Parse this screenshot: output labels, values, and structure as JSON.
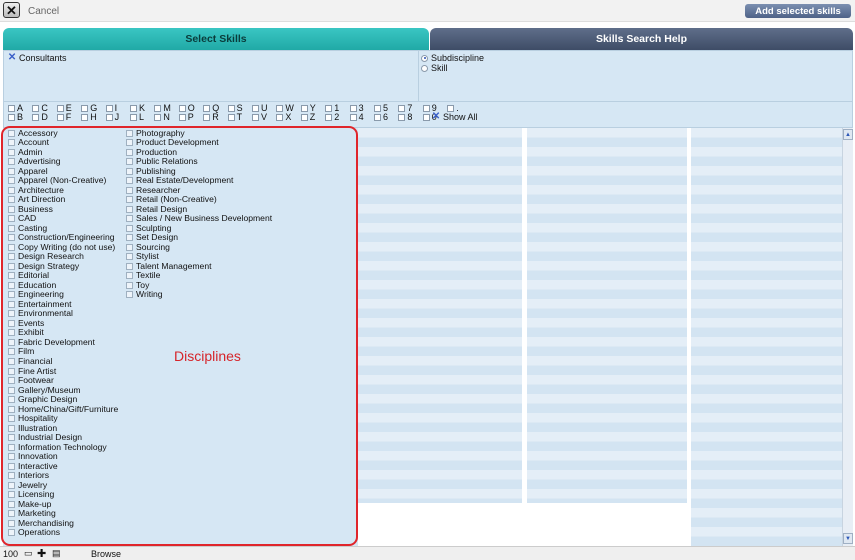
{
  "window": {
    "cancel_label": "Cancel",
    "add_button": "Add selected skills"
  },
  "tabs": [
    {
      "label": "Select Skills"
    },
    {
      "label": "Skills Search Help"
    }
  ],
  "filters": {
    "consultants": "Consultants",
    "subdiscipline": "Subdiscipline",
    "skill": "Skill"
  },
  "letters_row1": [
    "A",
    "C",
    "E",
    "G",
    "I",
    "K",
    "M",
    "O",
    "Q",
    "S",
    "U",
    "W",
    "Y",
    "1",
    "3",
    "5",
    "7",
    "9",
    "."
  ],
  "letters_row2": [
    "B",
    "D",
    "F",
    "H",
    "J",
    "L",
    "N",
    "P",
    "R",
    "T",
    "V",
    "X",
    "Z",
    "2",
    "4",
    "6",
    "8",
    "0"
  ],
  "show_all": "Show All",
  "disciplines_col1": [
    "Accessory",
    "Account",
    "Admin",
    "Advertising",
    "Apparel",
    "Apparel (Non-Creative)",
    "Architecture",
    "Art Direction",
    "Business",
    "CAD",
    "Casting",
    "Construction/Engineering",
    "Copy Writing (do not use)",
    "Design Research",
    "Design Strategy",
    "Editorial",
    "Education",
    "Engineering",
    "Entertainment",
    "Environmental",
    "Events",
    "Exhibit",
    "Fabric Development",
    "Film",
    "Financial",
    "Fine Artist",
    "Footwear",
    "Gallery/Museum",
    "Graphic Design",
    "Home/China/Gift/Furniture",
    "Hospitality",
    "Illustration",
    "Industrial Design",
    "Information Technology",
    "Innovation",
    "Interactive",
    "Interiors",
    "Jewelry",
    "Licensing",
    "Make-up",
    "Marketing",
    "Merchandising",
    "Operations"
  ],
  "disciplines_col2": [
    "Photography",
    "Product Development",
    "Production",
    "Public Relations",
    "Publishing",
    "Real Estate/Development",
    "Researcher",
    "Retail  (Non-Creative)",
    "Retail Design",
    "Sales / New Business Development",
    "Sculpting",
    "Set Design",
    "Sourcing",
    "Stylist",
    "Talent Management",
    "Textile",
    "Toy",
    "Writing"
  ],
  "annotation": "Disciplines",
  "status": {
    "zoom": "100",
    "mode": "Browse"
  },
  "colors": {
    "tab_active": "#2ab8b5",
    "tab_inactive": "#4a5873",
    "panel": "#d6e7f4",
    "highlight": "#e0252b"
  }
}
